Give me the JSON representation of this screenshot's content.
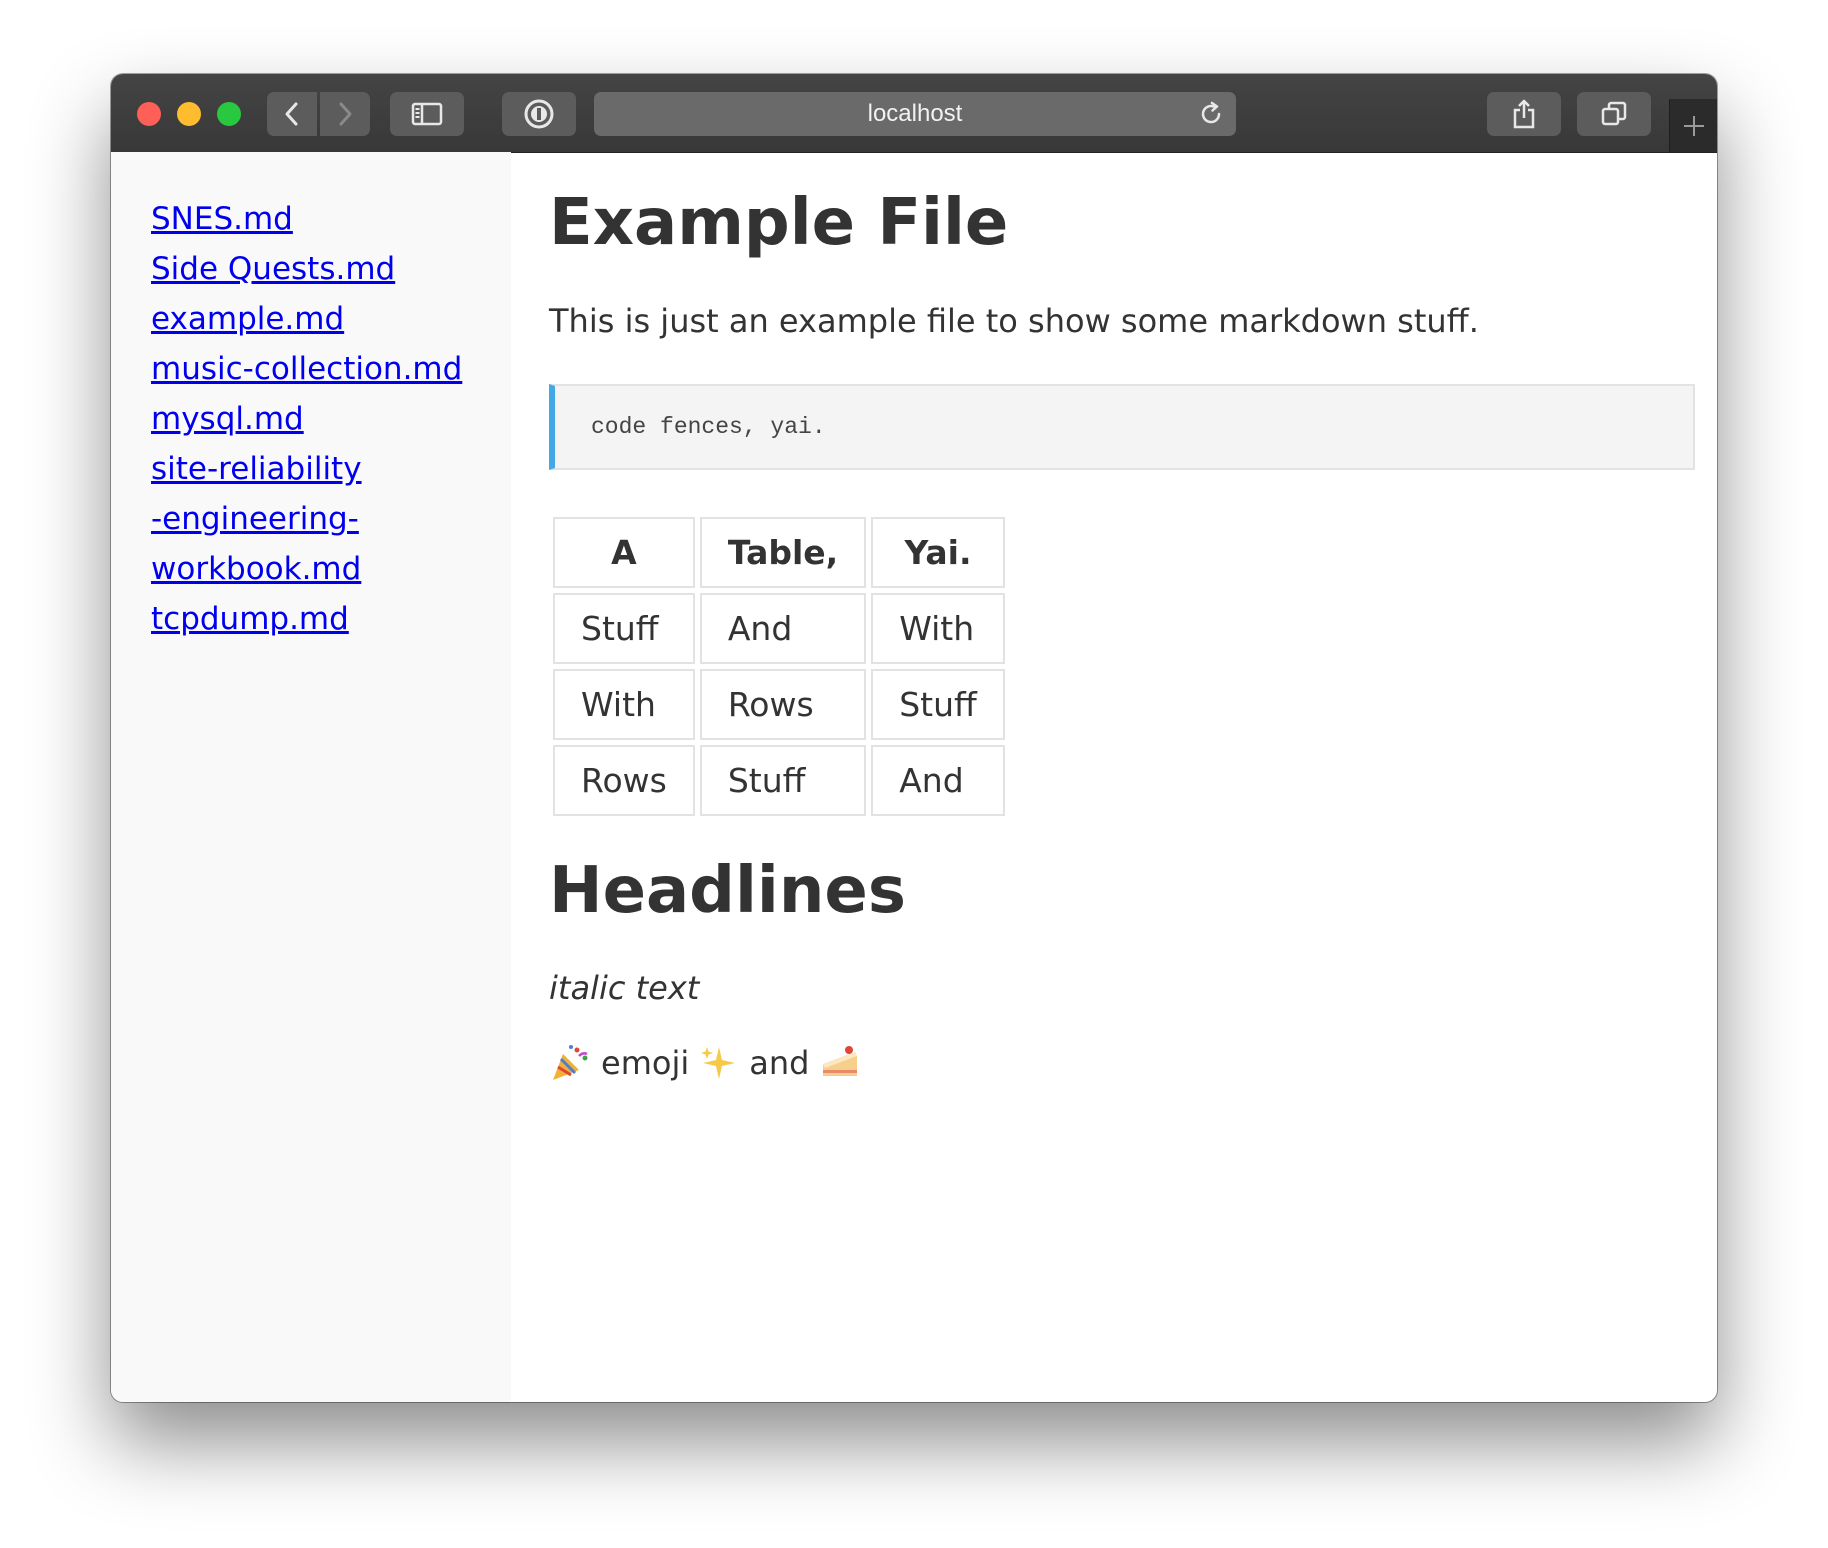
{
  "browser": {
    "url": "localhost"
  },
  "sidebar": {
    "links": [
      "SNES.md",
      "Side Quests.md",
      "example.md",
      "music-collection.md",
      "mysql.md",
      "site-reliability-engineering-workbook.md",
      "tcpdump.md"
    ]
  },
  "content": {
    "title": "Example File",
    "lead": "This is just an example file to show some markdown stuff.",
    "code": "code fences, yai.",
    "table": {
      "headers": [
        "A",
        "Table,",
        "Yai."
      ],
      "rows": [
        [
          "Stuff",
          "And",
          "With"
        ],
        [
          "With",
          "Rows",
          "Stuff"
        ],
        [
          "Rows",
          "Stuff",
          "And"
        ]
      ]
    },
    "headline": "Headlines",
    "italic": "italic text",
    "emoji_line": {
      "word1": "emoji",
      "word2": "and"
    }
  },
  "colors": {
    "link": "#0000ee",
    "code_accent": "#41a9e6",
    "titlebar": "#3d3d3d"
  },
  "icons": [
    "close-window-icon",
    "minimize-window-icon",
    "zoom-window-icon",
    "chevron-left-icon",
    "chevron-right-icon",
    "sidebar-icon",
    "password-manager-icon",
    "reload-icon",
    "share-icon",
    "tabs-overview-icon",
    "plus-icon",
    "party-popper-icon",
    "sparkles-icon",
    "cake-icon"
  ]
}
